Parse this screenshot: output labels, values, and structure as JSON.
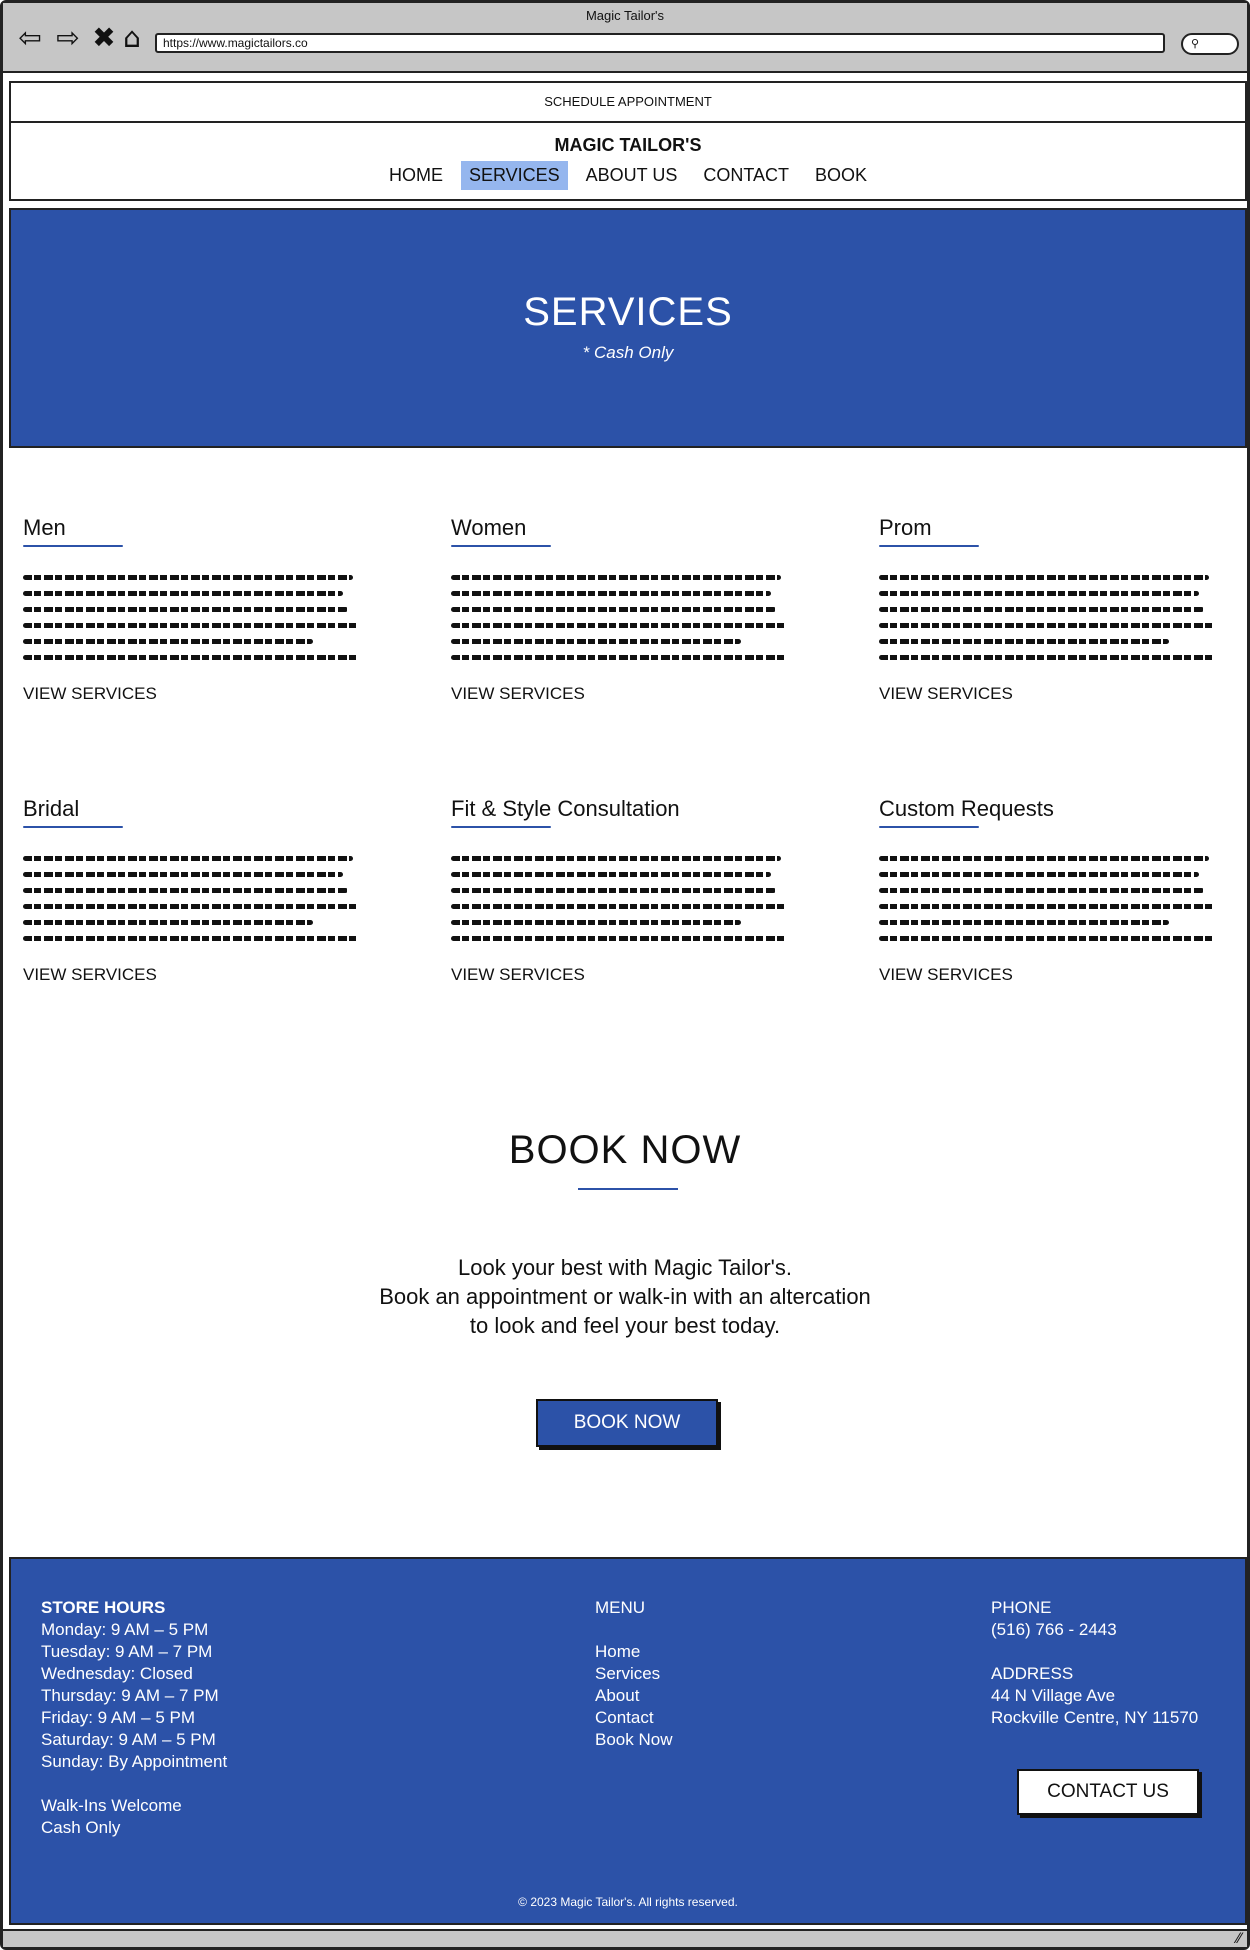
{
  "browser": {
    "title": "Magic Tailor's",
    "url": "https://www.magictailors.co"
  },
  "top_bar": {
    "schedule_label": "SCHEDULE APPOINTMENT"
  },
  "header": {
    "brand": "MAGIC TAILOR'S",
    "nav": [
      {
        "label": "HOME"
      },
      {
        "label": "SERVICES",
        "active": true
      },
      {
        "label": "ABOUT US"
      },
      {
        "label": "CONTACT"
      },
      {
        "label": "BOOK"
      }
    ]
  },
  "hero": {
    "title": "SERVICES",
    "subtitle": "* Cash Only"
  },
  "services": [
    {
      "title": "Men",
      "link": "VIEW SERVICES"
    },
    {
      "title": "Women",
      "link": "VIEW SERVICES"
    },
    {
      "title": "Prom",
      "link": "VIEW SERVICES"
    },
    {
      "title": "Bridal",
      "link": "VIEW SERVICES"
    },
    {
      "title": "Fit & Style Consultation",
      "link": "VIEW SERVICES"
    },
    {
      "title": "Custom Requests",
      "link": "VIEW SERVICES"
    }
  ],
  "book": {
    "title": "BOOK NOW",
    "lines": [
      "Look your best with Magic Tailor's.",
      "Book an appointment or walk-in with an altercation",
      "to look and feel your best today."
    ],
    "button": "BOOK NOW"
  },
  "footer": {
    "hours_title": "STORE HOURS",
    "hours": [
      "Monday: 9 AM – 5 PM",
      "Tuesday: 9 AM – 7 PM",
      "Wednesday: Closed",
      "Thursday: 9 AM – 7 PM",
      "Friday: 9 AM – 5 PM",
      "Saturday: 9 AM – 5 PM",
      "Sunday: By Appointment"
    ],
    "notes": [
      "Walk-Ins Welcome",
      "Cash Only"
    ],
    "menu_title": "MENU",
    "menu": [
      "Home",
      "Services",
      "About",
      "Contact",
      "Book Now"
    ],
    "phone_label": "PHONE",
    "phone": "(516) 766 - 2443",
    "address_label": "ADDRESS",
    "address_line1": "44 N Village Ave",
    "address_line2": "Rockville Centre, NY 11570",
    "contact_button": "CONTACT US",
    "copyright": "© 2023 Magic Tailor's. All rights reserved."
  },
  "colors": {
    "brand_blue": "#2c52a8",
    "nav_highlight": "#95b6ee",
    "chrome_gray": "#c6c6c6"
  }
}
